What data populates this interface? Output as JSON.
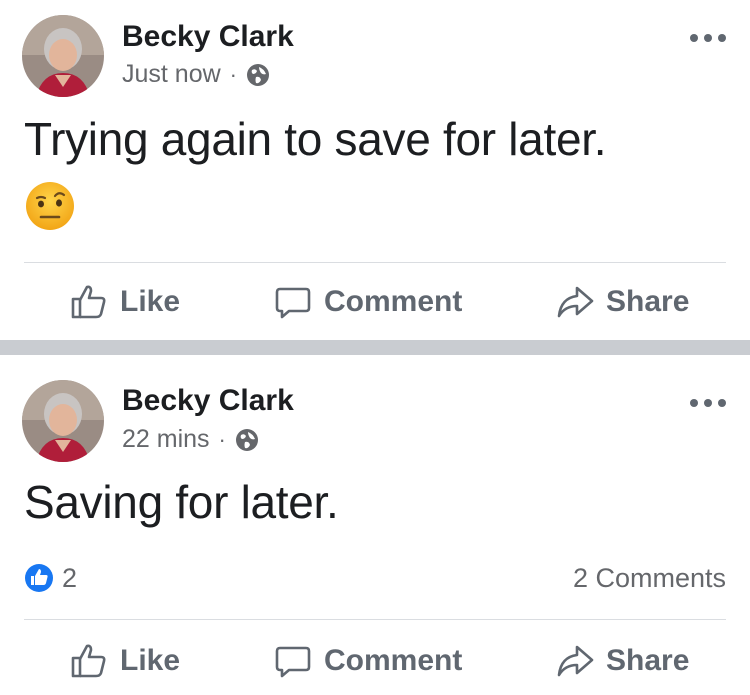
{
  "posts": [
    {
      "author": "Becky Clark",
      "time": "Just now",
      "separator": "·",
      "privacy_icon": "globe-icon",
      "text": "Trying again to save for later.",
      "emoji": "raised-eyebrow-face",
      "actions": {
        "like": "Like",
        "comment": "Comment",
        "share": "Share"
      }
    },
    {
      "author": "Becky Clark",
      "time": "22 mins",
      "separator": "·",
      "privacy_icon": "globe-icon",
      "text": "Saving for later.",
      "reactions": {
        "like_count": "2",
        "comments": "2 Comments"
      },
      "actions": {
        "like": "Like",
        "comment": "Comment",
        "share": "Share"
      }
    }
  ],
  "colors": {
    "primary_text": "#1c1e21",
    "secondary_text": "#65676b",
    "action_text": "#606770",
    "like_blue": "#1877f2",
    "separator": "#c9ccd1"
  }
}
